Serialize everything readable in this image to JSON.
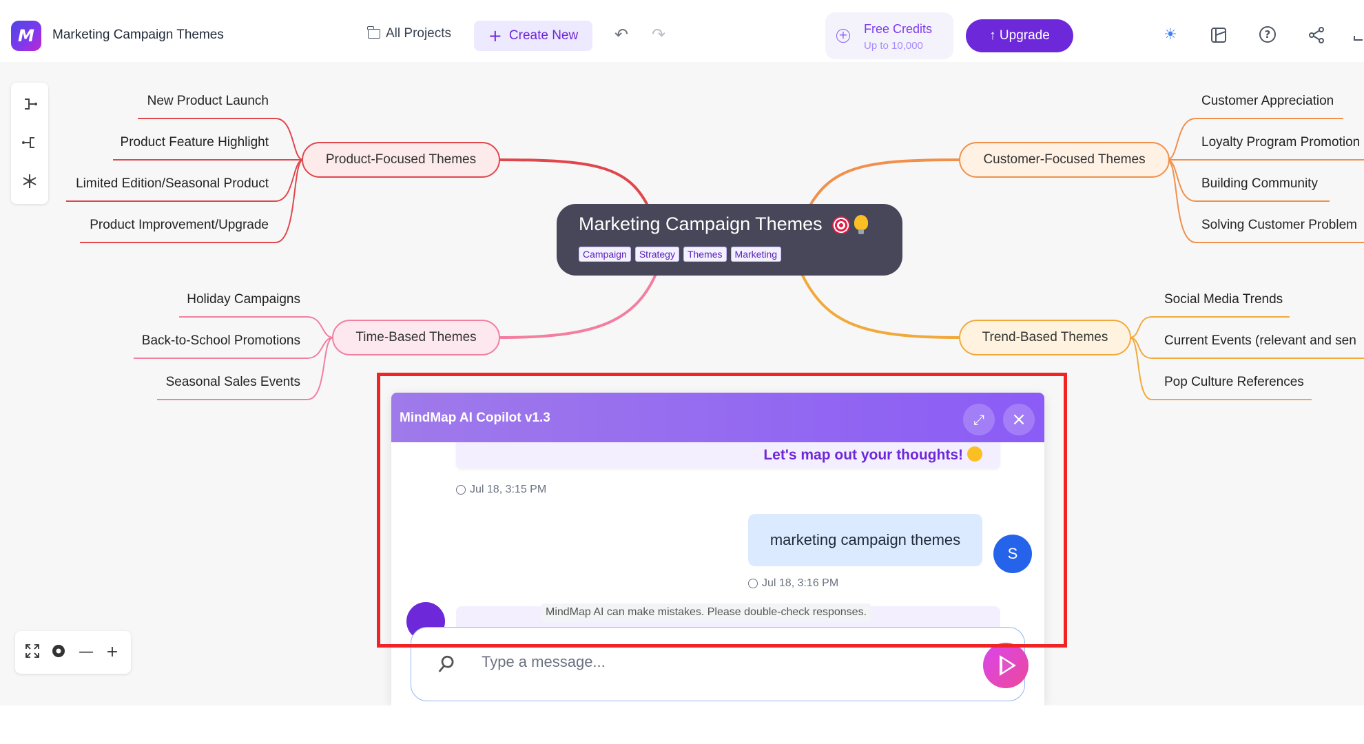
{
  "app": {
    "title": "Marketing Campaign Themes",
    "logo_label": "M"
  },
  "nav": {
    "all_projects": "All Projects",
    "create_new": "Create New",
    "credits_title": "Free Credits",
    "credits_subtitle": "Up to 10,000",
    "upgrade": "↑ Upgrade"
  },
  "colors": {
    "accent": "#6d28d9",
    "product_branch": "#e0474c",
    "customer_branch": "#f0904b",
    "time_branch": "#f37e9f",
    "trend_branch": "#f2a93b",
    "root_node": "#474759",
    "highlight_box": "#f02424"
  },
  "mindmap": {
    "root": {
      "title": "Marketing Campaign Themes",
      "tags": [
        "Campaign",
        "Strategy",
        "Themes",
        "Marketing"
      ]
    },
    "branches": {
      "product": {
        "label": "Product-Focused Themes",
        "leaves": [
          "New Product Launch",
          "Product Feature Highlight",
          "Limited Edition/Seasonal Product",
          "Product Improvement/Upgrade"
        ]
      },
      "customer": {
        "label": "Customer-Focused Themes",
        "leaves": [
          "Customer Appreciation",
          "Loyalty Program Promotion",
          "Building Community",
          "Solving Customer Problem"
        ]
      },
      "time": {
        "label": "Time-Based Themes",
        "leaves": [
          "Holiday Campaigns",
          "Back-to-School Promotions",
          "Seasonal Sales Events"
        ]
      },
      "trend": {
        "label": "Trend-Based Themes",
        "leaves": [
          "Social Media Trends",
          "Current Events (relevant and sen",
          "Pop Culture References"
        ]
      }
    }
  },
  "tools": {
    "left": [
      "branch-right-icon",
      "branch-left-icon",
      "radial-layout-icon"
    ],
    "zoom": [
      "fullscreen-icon",
      "locate-icon",
      "zoom-out-icon",
      "zoom-in-icon"
    ],
    "top_right": [
      "theme-sun-icon",
      "layout-icon",
      "help-icon",
      "share-icon"
    ]
  },
  "chat": {
    "title": "MindMap AI Copilot v1.3",
    "messages": [
      {
        "role": "bot",
        "text": "Let's map out your thoughts!",
        "time": "Jul 18, 3:15 PM"
      },
      {
        "role": "user",
        "text": "marketing campaign themes",
        "time": "Jul 18, 3:16 PM",
        "avatar": "S"
      }
    ],
    "disclaimer": "MindMap AI can make mistakes. Please double-check responses.",
    "input_placeholder": "Type a message..."
  }
}
